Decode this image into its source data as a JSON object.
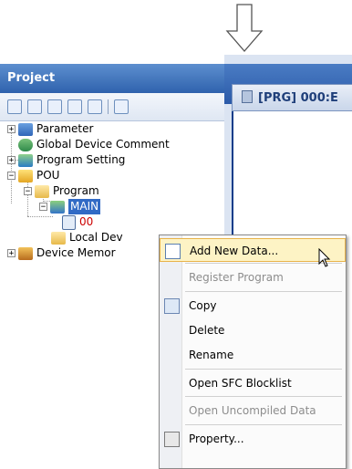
{
  "project": {
    "title": "Project",
    "tree": [
      {
        "label": "Parameter",
        "icon": "parameter-icon"
      },
      {
        "label": "Global Device Comment",
        "icon": "global-device-comment-icon"
      },
      {
        "label": "Program Setting",
        "icon": "program-setting-icon"
      },
      {
        "label": "POU",
        "icon": "pou-icon"
      },
      {
        "label": "Program",
        "icon": "folder-icon"
      },
      {
        "label": "MAIN",
        "icon": "program-icon"
      },
      {
        "label": "00",
        "icon": "program-file-icon"
      },
      {
        "label": "Local Dev",
        "icon": "folder-icon"
      },
      {
        "label": "Device Memor",
        "icon": "device-memory-icon"
      }
    ]
  },
  "editor": {
    "tab_title": "[PRG] 000:E"
  },
  "context_menu": {
    "items": [
      {
        "label": "Add New Data...",
        "state": "highlighted"
      },
      {
        "label": "Register Program",
        "state": "disabled"
      },
      {
        "label": "Copy",
        "state": "enabled"
      },
      {
        "label": "Delete",
        "state": "enabled"
      },
      {
        "label": "Rename",
        "state": "enabled"
      },
      {
        "label": "Open SFC Blocklist",
        "state": "enabled"
      },
      {
        "label": "Open Uncompiled Data",
        "state": "disabled"
      },
      {
        "label": "Property...",
        "state": "enabled"
      }
    ]
  },
  "colors": {
    "header_blue": "#2f62ad",
    "selection": "#316ac5",
    "menu_highlight": "#fdf3c5",
    "menu_highlight_border": "#e8b34a"
  }
}
